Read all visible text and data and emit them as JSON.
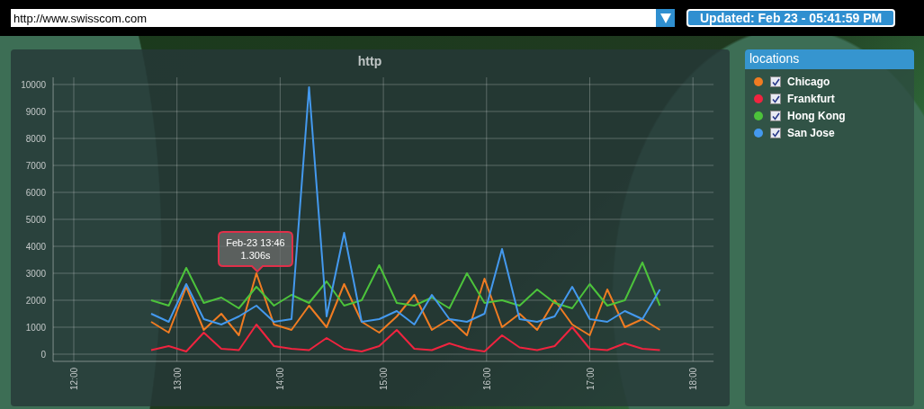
{
  "url_select": {
    "value": "http://www.swisscom.com"
  },
  "updated": "Updated: Feb 23 - 05:41:59 PM",
  "chart": {
    "chart_data": {
      "type": "line",
      "title": "http",
      "x": [
        12.75,
        12.92,
        13.09,
        13.26,
        13.43,
        13.6,
        13.77,
        13.94,
        14.11,
        14.28,
        14.45,
        14.62,
        14.79,
        14.96,
        15.13,
        15.3,
        15.47,
        15.64,
        15.81,
        15.98,
        16.15,
        16.32,
        16.49,
        16.66,
        16.83,
        17,
        17.17,
        17.34,
        17.51,
        17.68
      ],
      "series": [
        {
          "color": "#f07c22",
          "values": [
            1200,
            800,
            2500,
            900,
            1500,
            700,
            3000,
            1100,
            900,
            1800,
            1000,
            2600,
            1200,
            800,
            1400,
            2200,
            900,
            1300,
            700,
            2800,
            1000,
            1500,
            900,
            2000,
            1100,
            700,
            2400,
            1000,
            1300,
            900
          ]
        },
        {
          "color": "#f0243f",
          "values": [
            150,
            300,
            100,
            800,
            200,
            150,
            1100,
            300,
            200,
            150,
            600,
            200,
            100,
            300,
            900,
            200,
            150,
            400,
            200,
            100,
            700,
            250,
            150,
            300,
            1000,
            200,
            150,
            400,
            200,
            150
          ]
        },
        {
          "color": "#4cc33b",
          "values": [
            2000,
            1800,
            3200,
            1900,
            2100,
            1700,
            2500,
            1800,
            2200,
            1900,
            2700,
            1800,
            2000,
            3300,
            1900,
            1800,
            2100,
            1700,
            3000,
            1900,
            2000,
            1800,
            2400,
            1900,
            1700,
            2600,
            1800,
            2000,
            3400,
            1800
          ]
        },
        {
          "color": "#4499ee",
          "values": [
            1500,
            1200,
            2600,
            1300,
            1100,
            1400,
            1800,
            1200,
            1300,
            9900,
            1400,
            4500,
            1200,
            1300,
            1600,
            1100,
            2200,
            1300,
            1200,
            1500,
            3900,
            1300,
            1200,
            1400,
            2500,
            1300,
            1200,
            1600,
            1300,
            2400
          ]
        }
      ],
      "xlim": [
        11.8,
        18.2
      ],
      "grid": true,
      "ylim": [
        0,
        10000
      ],
      "xticks": [
        {
          "value": 12,
          "label": "12:00"
        },
        {
          "value": 13,
          "label": "13:00"
        },
        {
          "value": 14,
          "label": "14:00"
        },
        {
          "value": 15,
          "label": "15:00"
        },
        {
          "value": 16,
          "label": "16:00"
        },
        {
          "value": 17,
          "label": "17:00"
        },
        {
          "value": 18,
          "label": "18:00"
        }
      ],
      "yticks": [
        0,
        1000,
        2000,
        3000,
        4000,
        5000,
        6000,
        7000,
        8000,
        9000,
        10000
      ]
    },
    "tooltip": {
      "title": "Feb-23 13:46",
      "value": "1.306s"
    }
  },
  "locations": {
    "title": "locations",
    "items": [
      {
        "name": "Chicago",
        "color": "#f07c22",
        "checked": true
      },
      {
        "name": "Frankfurt",
        "color": "#f0243f",
        "checked": true
      },
      {
        "name": "Hong Kong",
        "color": "#4cc33b",
        "checked": true
      },
      {
        "name": "San Jose",
        "color": "#4499ee",
        "checked": true
      }
    ]
  }
}
